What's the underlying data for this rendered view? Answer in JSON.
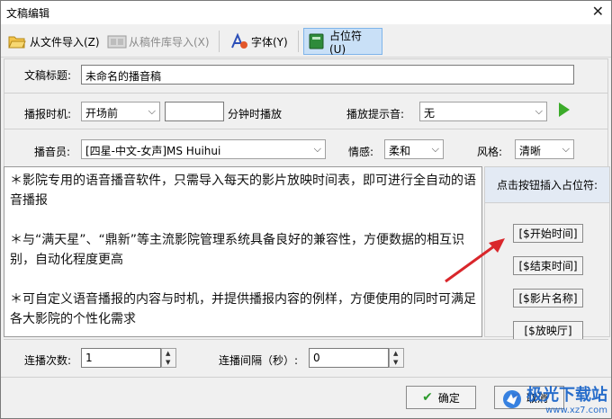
{
  "window": {
    "title": "文稿编辑"
  },
  "toolbar": {
    "import_file": "从文件导入(Z)",
    "import_library": "从稿件库导入(X)",
    "font": "字体(Y)",
    "placeholder": "占位符(U)"
  },
  "form": {
    "title_label": "文稿标题:",
    "title_value": "未命名的播音稿",
    "time_label": "播报时机:",
    "time_value": "开场前",
    "minutes_value": "",
    "minutes_suffix": "分钟时播放",
    "tone_label": "播放提示音:",
    "tone_value": "无",
    "announcer_label": "播音员:",
    "announcer_value": "[四星-中文-女声]MS Huihui",
    "emotion_label": "情感:",
    "emotion_value": "柔和",
    "style_label": "风格:",
    "style_value": "清晰"
  },
  "editor": {
    "paragraphs": [
      "＊影院专用的语音播音软件，只需导入每天的影片放映时间表，即可进行全自动的语音播报",
      "＊与“满天星”、“鼎新”等主流影院管理系统具备良好的兼容性，方便数据的相互识别，自动化程度更高",
      "＊可自定义语音播报的内容与时机，并提供播报内容的例样，方便使用的同时可满足各大影院的个性化需求"
    ]
  },
  "placeholders": {
    "header": "点击按钮插入占位符:",
    "buttons": [
      "[$开始时间]",
      "[$结束时间]",
      "[$影片名称]",
      "[$放映厅]"
    ]
  },
  "repeat": {
    "count_label": "连播次数:",
    "count_value": "1",
    "interval_label": "连播间隔（秒）:",
    "interval_value": "0"
  },
  "footer": {
    "ok_label": "确定",
    "cancel_label": "取消"
  },
  "watermark": {
    "text": "极光下载站",
    "url": "www.xz7.com"
  },
  "colors": {
    "accent_active": "#c9e0f7",
    "play_green": "#3cab2a",
    "arrow_red": "#d9262b"
  }
}
